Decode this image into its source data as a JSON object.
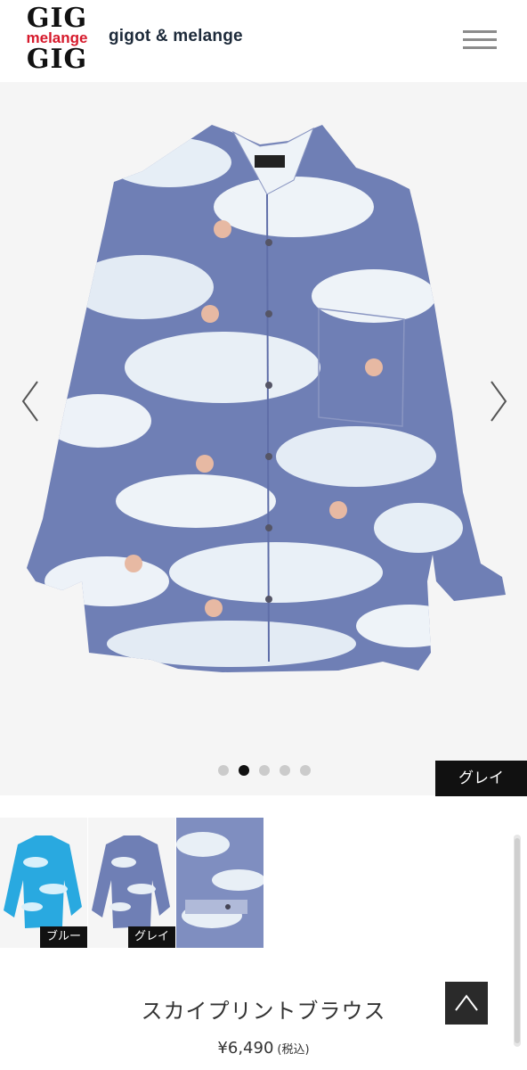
{
  "header": {
    "logo_top": "GIG",
    "logo_middle": "melange",
    "logo_bottom": "GIG",
    "brand": "gigot & melange",
    "menu_icon": "hamburger-menu-icon"
  },
  "hero": {
    "image": "blouse-grey-front",
    "prev_icon": "chevron-left-icon",
    "next_icon": "chevron-right-icon",
    "slide_count": 5,
    "active_slide": 2,
    "color_label": "グレイ"
  },
  "thumbnails": [
    {
      "image": "blouse-blue",
      "tag": "ブルー"
    },
    {
      "image": "blouse-grey",
      "tag": "グレイ"
    },
    {
      "image": "blouse-detail-cuff",
      "tag": ""
    }
  ],
  "product": {
    "name": "スカイプリントブラウス",
    "price": "¥6,490",
    "tax_note": "(税込)"
  },
  "back_to_top_icon": "caret-up-icon",
  "colors": {
    "brand_red": "#d6192b",
    "dark": "#111111",
    "shirt_blue": "#6f7fb5",
    "thumb_blue": "#29a9e0"
  }
}
